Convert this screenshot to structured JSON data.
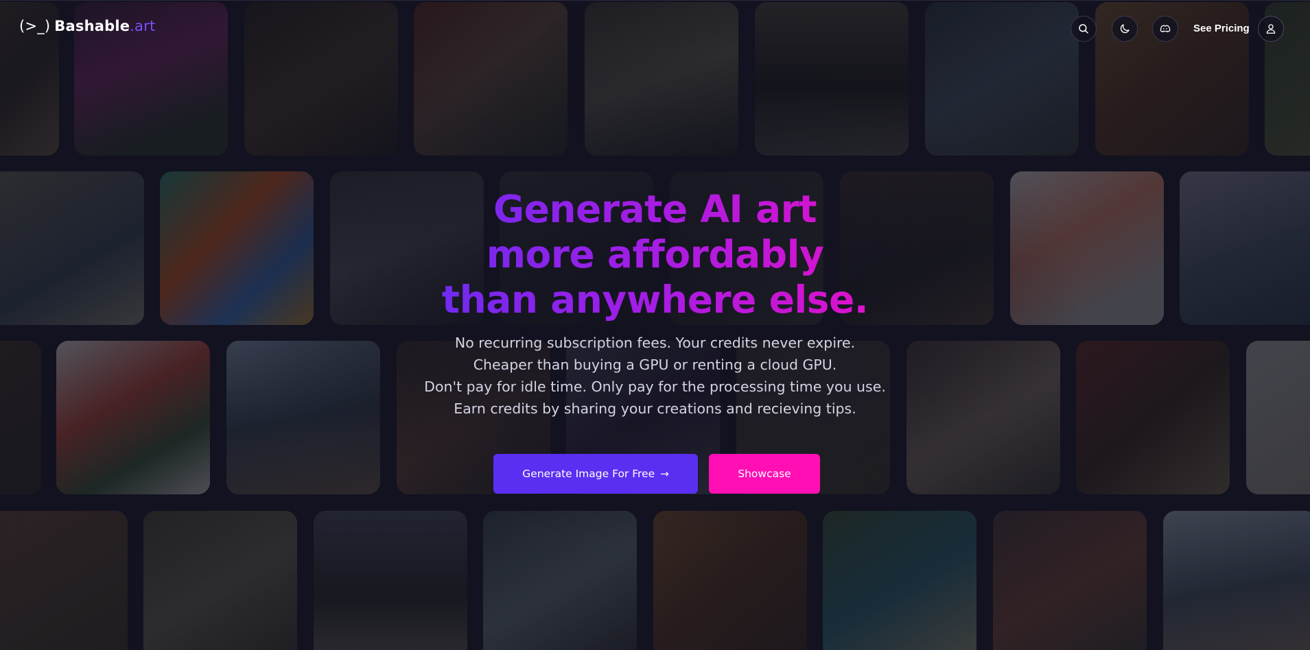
{
  "header": {
    "logo_prompt": "(>_)",
    "logo_name": "Bashable",
    "logo_tld": ".art",
    "pricing_label": "See Pricing",
    "icons": [
      "search-icon",
      "moon-icon",
      "discord-icon",
      "user-icon"
    ]
  },
  "hero": {
    "headline_line1": "Generate AI art",
    "headline_line2": "more affordably",
    "headline_line3": "than anywhere else.",
    "sub_line1": "No recurring subscription fees. Your credits never expire.",
    "sub_line2": "Cheaper than buying a GPU or renting a cloud GPU.",
    "sub_line3": "Don't pay for idle time. Only pay for the processing time you use.",
    "sub_line4": "Earn credits by sharing your creations and recieving tips.",
    "primary_cta": "Generate Image For Free",
    "primary_cta_arrow": "→",
    "secondary_cta": "Showcase"
  },
  "colors": {
    "background": "#121220",
    "primary_button": "#5b2ff2",
    "secondary_button": "#ff0fb4",
    "headline_gradient_start": "#6a2cf0",
    "headline_gradient_end": "#e610c8",
    "logo_accent": "#7c4dff"
  }
}
